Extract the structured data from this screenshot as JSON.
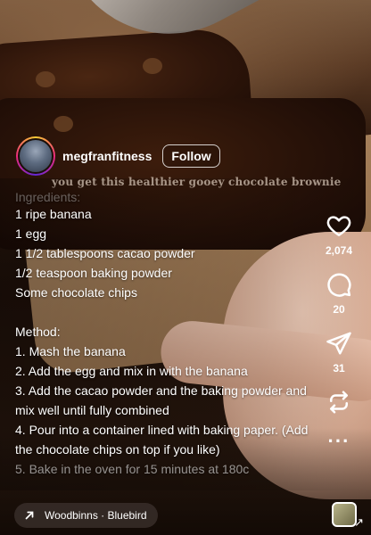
{
  "post": {
    "username": "megfranfitness",
    "follow_label": "Follow",
    "overlay_caption": "you get this healthier gooey chocolate brownie"
  },
  "recipe": {
    "header": "Ingredients:",
    "ingredients": [
      "1 ripe banana",
      "1 egg",
      "1 1/2 tablespoons cacao powder",
      "1/2 teaspoon baking powder",
      "Some chocolate chips"
    ],
    "method_header": "Method:",
    "steps": [
      "1. Mash the banana",
      "2. Add the egg and mix in with the banana",
      "3. Add the cacao powder and the baking powder and mix well until fully combined",
      "4. Pour into a container lined with baking paper. (Add the chocolate chips on top if you like)",
      "5. Bake in the oven for 15 minutes at 180c"
    ]
  },
  "actions": {
    "likes": "2,074",
    "comments": "20",
    "shares": "31"
  },
  "audio": {
    "label": "Woodbinns · Bluebird"
  }
}
